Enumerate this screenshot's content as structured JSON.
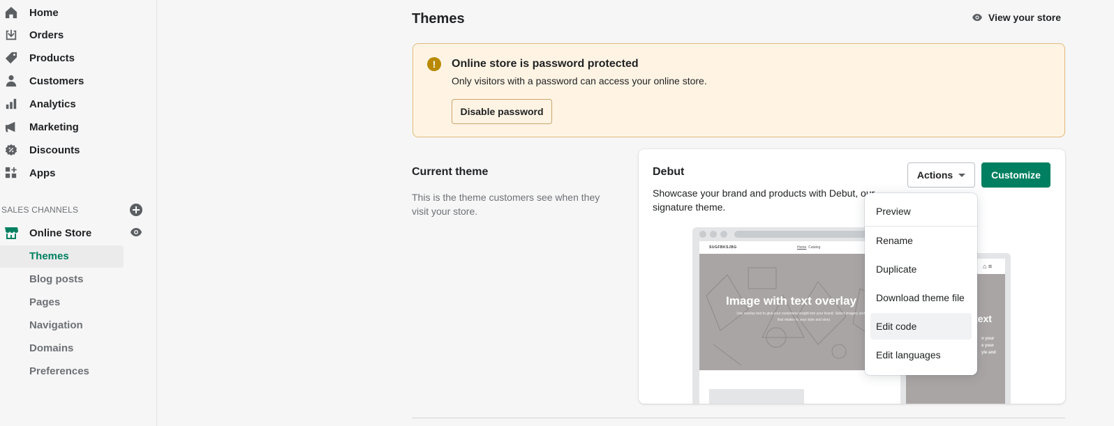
{
  "sidebar": {
    "items": [
      {
        "label": "Home",
        "icon": "home-icon"
      },
      {
        "label": "Orders",
        "icon": "orders-icon"
      },
      {
        "label": "Products",
        "icon": "tag-icon"
      },
      {
        "label": "Customers",
        "icon": "person-icon"
      },
      {
        "label": "Analytics",
        "icon": "bar-chart-icon"
      },
      {
        "label": "Marketing",
        "icon": "megaphone-icon"
      },
      {
        "label": "Discounts",
        "icon": "discount-icon"
      },
      {
        "label": "Apps",
        "icon": "apps-icon"
      }
    ],
    "sales_channels_label": "SALES CHANNELS",
    "online_store": {
      "label": "Online Store"
    },
    "sub_items": [
      {
        "label": "Themes"
      },
      {
        "label": "Blog posts"
      },
      {
        "label": "Pages"
      },
      {
        "label": "Navigation"
      },
      {
        "label": "Domains"
      },
      {
        "label": "Preferences"
      }
    ]
  },
  "header": {
    "title": "Themes",
    "view_store": "View your store"
  },
  "banner": {
    "title": "Online store is password protected",
    "text": "Only visitors with a password can access your online store.",
    "button": "Disable password"
  },
  "current_theme": {
    "heading": "Current theme",
    "description": "This is the theme customers see when they visit your store."
  },
  "theme_card": {
    "name": "Debut",
    "description": "Showcase your brand and products with Debut, our signature theme.",
    "actions_label": "Actions",
    "customize_label": "Customize"
  },
  "preview": {
    "store_name": "SUGFBKSJBG",
    "nav_home": "Home",
    "nav_catalog": "Catalog",
    "hero_title": "Image with text overlay",
    "hero_sub": "Use overlay text to give your customers insight into your brand. Select imagery and text that relates to your style and story.",
    "mobile_title": "text",
    "mobile_sub": "n your\ne your\nyle and"
  },
  "actions_menu": [
    {
      "label": "Preview"
    },
    {
      "label": "Rename"
    },
    {
      "label": "Duplicate"
    },
    {
      "label": "Download theme file"
    },
    {
      "label": "Edit code"
    },
    {
      "label": "Edit languages"
    }
  ],
  "colors": {
    "accent": "#008060",
    "banner_bg": "#fff4e4",
    "warning": "#b98900"
  }
}
